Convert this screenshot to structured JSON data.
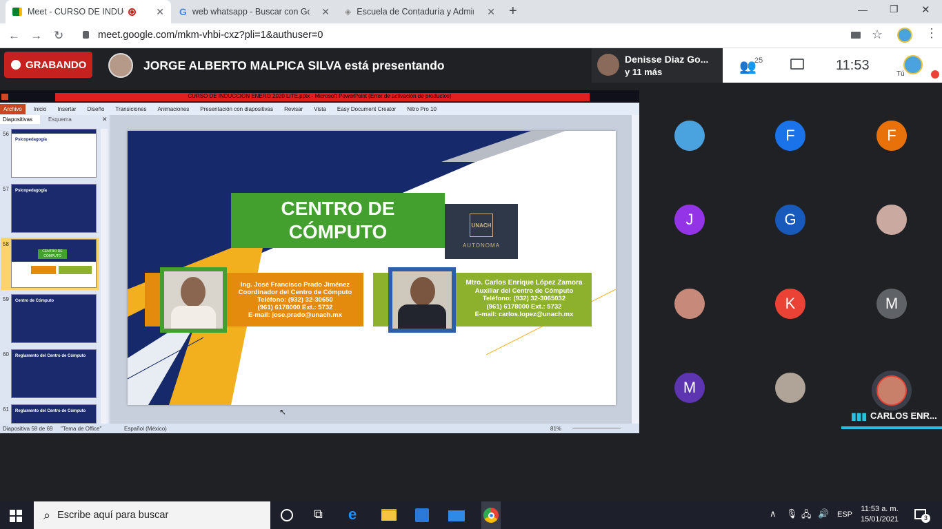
{
  "browser": {
    "tabs": [
      {
        "title": "Meet - CURSO DE INDUCCIÓ",
        "active": true
      },
      {
        "title": "web whatsapp - Buscar con Goo",
        "active": false
      },
      {
        "title": "Escuela de Contaduría y Adminis",
        "active": false
      }
    ],
    "new_tab": "+",
    "url": "meet.google.com/mkm-vhbi-cxz?pli=1&authuser=0",
    "window_controls": {
      "minimize": "—",
      "restore": "❐",
      "close": "✕"
    }
  },
  "meet": {
    "recording_label": "GRABANDO",
    "presenter_text": "JORGE ALBERTO MALPICA SILVA está presentando",
    "pinned_name": "Denisse Diaz Go...",
    "pinned_more": "y 11 más",
    "people_count": "25",
    "time": "11:53",
    "self_label": "Tú",
    "speaker_name": "CARLOS ENR...",
    "participants": [
      {
        "letter": "",
        "color": "#4aa3df"
      },
      {
        "letter": "F",
        "color": "#1a73e8"
      },
      {
        "letter": "F",
        "color": "#e8710a"
      },
      {
        "letter": "J",
        "color": "#9334e6"
      },
      {
        "letter": "G",
        "color": "#185abc"
      },
      {
        "letter": "",
        "color": "#c9a9a0"
      },
      {
        "letter": "",
        "color": "#c78a7a"
      },
      {
        "letter": "K",
        "color": "#ea4335"
      },
      {
        "letter": "M",
        "color": "#5f6368"
      },
      {
        "letter": "M",
        "color": "#5e35b1"
      },
      {
        "letter": "",
        "color": "#b0a397"
      },
      {
        "letter": "",
        "color": "#3a3f4a"
      }
    ]
  },
  "ppt": {
    "window_title": "CURSO DE INDUCCION ENERO 2020 LITE.pptx - Microsoft PowerPoint (Error de activación de productos)",
    "menu": [
      "Archivo",
      "Inicio",
      "Insertar",
      "Diseño",
      "Transiciones",
      "Animaciones",
      "Presentación con diapositivas",
      "Revisar",
      "Vista",
      "Easy Document Creator",
      "Nitro Pro 10"
    ],
    "panel_tabs": [
      "Diapositivas",
      "Esquema"
    ],
    "thumb_numbers": [
      "56",
      "57",
      "58",
      "59",
      "60",
      "61"
    ],
    "thumb_titles": [
      "Psicopedagogía",
      "Psicopedagogía",
      "CENTRO DE CÓMPUTO",
      "Centro de Cómputo",
      "Reglamento del Centro de Cómputo",
      "Reglamento del Centro de Cómputo"
    ],
    "status": {
      "slide": "Diapositiva 58 de 69",
      "theme": "\"Tema de Office\"",
      "lang": "Español (México)",
      "zoom": "81%"
    },
    "slide": {
      "title_line1": "CENTRO DE",
      "title_line2": "CÓMPUTO",
      "logo_text": "UNACH",
      "logo_sub": "AUTONOMA",
      "left": {
        "name": "Ing. José Francisco Prado Jiménez",
        "role": "Coordinador del Centro de Cómputo",
        "phone": "Teléfono: (932) 32-30650",
        "ext": "(961) 6178000 Ext.: 5732",
        "email": "E-mail:  jose.prado@unach.mx"
      },
      "right": {
        "name": "Mtro. Carlos Enrique López Zamora",
        "role": "Auxiliar del Centro de Cómputo",
        "phone": "Teléfono: (932) 32-3065032",
        "ext": "(961) 6178000 Ext.: 5732",
        "email": "E-mail: carlos.lopez@unach.mx"
      }
    }
  },
  "taskbar": {
    "search_placeholder": "Escribe aquí para buscar",
    "lang": "ESP",
    "time": "11:53 a. m.",
    "date": "15/01/2021",
    "notifications": "3"
  }
}
